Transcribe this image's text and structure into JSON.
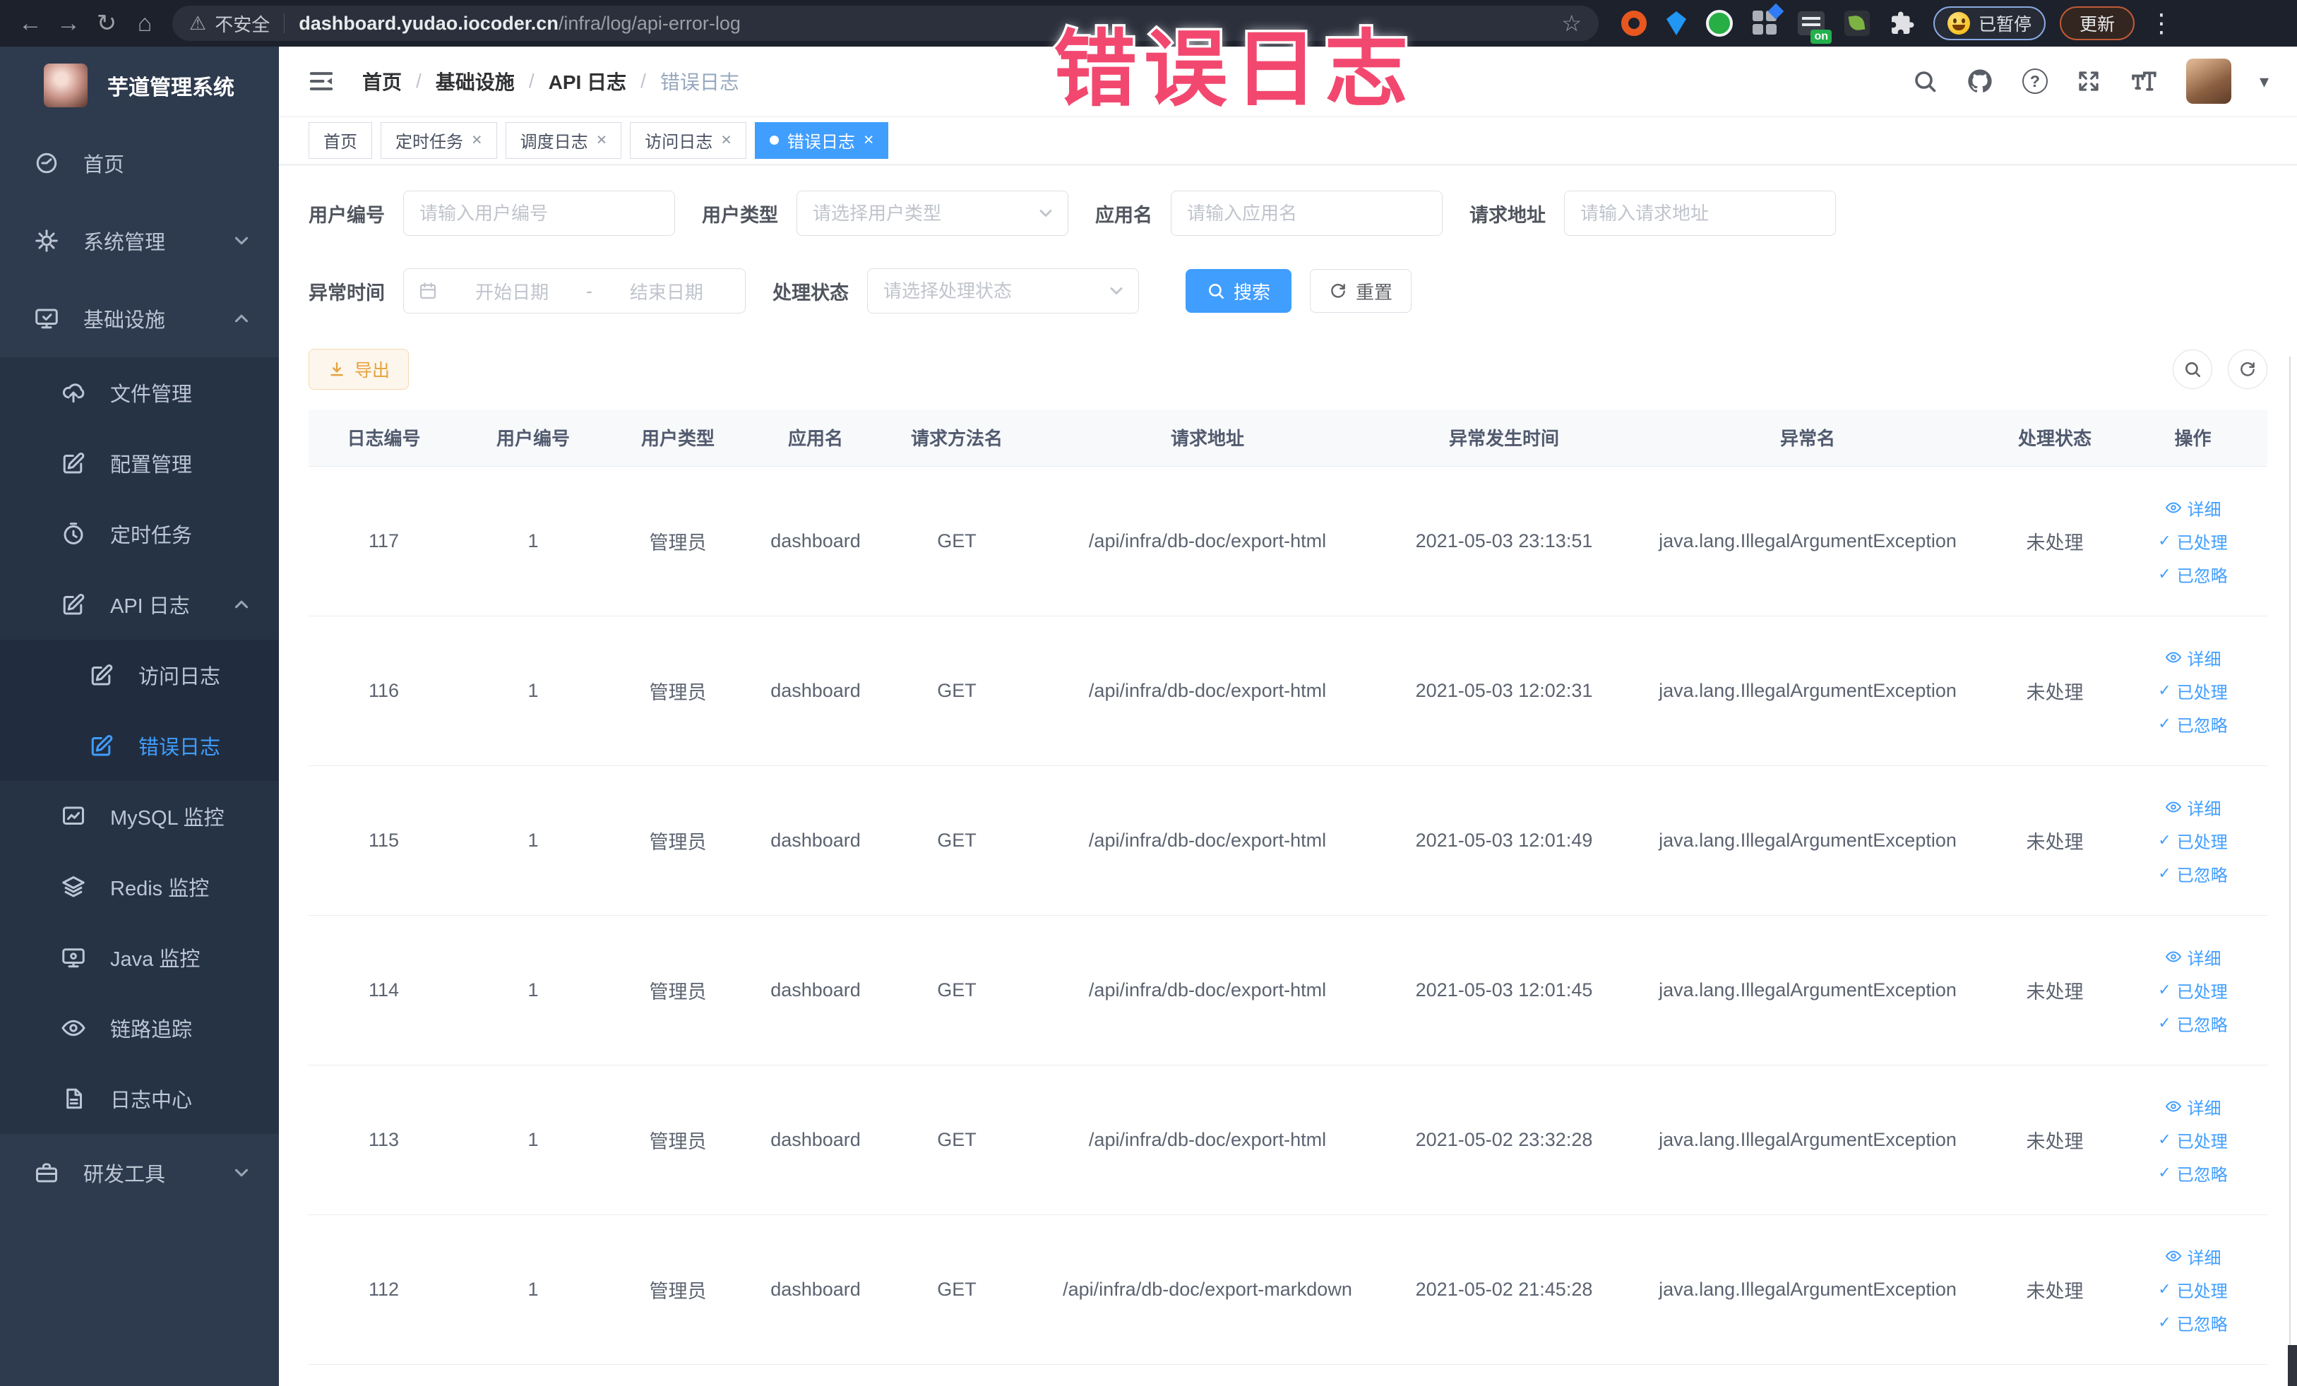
{
  "browser": {
    "security_label": "不安全",
    "url_domain": "dashboard.yudao.iocoder.cn",
    "url_path": "/infra/log/api-error-log",
    "paused_label": "已暂停",
    "update_label": "更新"
  },
  "overlay_title": "错误日志",
  "colors": {
    "accent": "#409eff",
    "sidebar_bg": "#2e3a4e",
    "sidebar_submenu_bg": "#263345",
    "active_link": "#409eff",
    "export_warning": "#e6a23c",
    "overlay_pink": "#f2486f"
  },
  "icons": {
    "back": "←",
    "forward": "→",
    "reload": "↻",
    "home": "⌂",
    "warning": "⚠",
    "star": "☆",
    "dots": "⋮",
    "close": "×",
    "caret_down": "▾",
    "check": "✓",
    "help": "?",
    "on_badge": "on",
    "breadcrumb_separator": "/"
  },
  "sidebar": {
    "logo_title": "芋道管理系统",
    "items": [
      {
        "label": "首页",
        "icon": "dashboard"
      },
      {
        "label": "系统管理",
        "icon": "gear"
      },
      {
        "label": "基础设施",
        "icon": "monitor"
      },
      {
        "label": "文件管理",
        "icon": "cloud-upload"
      },
      {
        "label": "配置管理",
        "icon": "edit"
      },
      {
        "label": "定时任务",
        "icon": "timer"
      },
      {
        "label": "API 日志",
        "icon": "edit"
      },
      {
        "label": "访问日志",
        "icon": "edit"
      },
      {
        "label": "错误日志",
        "icon": "edit"
      },
      {
        "label": "MySQL 监控",
        "icon": "chart"
      },
      {
        "label": "Redis 监控",
        "icon": "layers"
      },
      {
        "label": "Java 监控",
        "icon": "display"
      },
      {
        "label": "链路追踪",
        "icon": "eye"
      },
      {
        "label": "日志中心",
        "icon": "document"
      },
      {
        "label": "研发工具",
        "icon": "briefcase"
      }
    ]
  },
  "breadcrumb": [
    "首页",
    "基础设施",
    "API 日志",
    "错误日志"
  ],
  "tabs": [
    {
      "label": "首页"
    },
    {
      "label": "定时任务"
    },
    {
      "label": "调度日志"
    },
    {
      "label": "访问日志"
    },
    {
      "label": "错误日志"
    }
  ],
  "filters": {
    "user_id_label": "用户编号",
    "user_id_placeholder": "请输入用户编号",
    "user_type_label": "用户类型",
    "user_type_placeholder": "请选择用户类型",
    "app_name_label": "应用名",
    "app_name_placeholder": "请输入应用名",
    "request_url_label": "请求地址",
    "request_url_placeholder": "请输入请求地址",
    "exception_time_label": "异常时间",
    "date_start_placeholder": "开始日期",
    "date_separator": "-",
    "date_end_placeholder": "结束日期",
    "process_status_label": "处理状态",
    "process_status_placeholder": "请选择处理状态",
    "search_label": "搜索",
    "reset_label": "重置"
  },
  "toolbar": {
    "export_label": "导出"
  },
  "table": {
    "columns": [
      "日志编号",
      "用户编号",
      "用户类型",
      "应用名",
      "请求方法名",
      "请求地址",
      "异常发生时间",
      "异常名",
      "处理状态",
      "操作"
    ],
    "ops": {
      "detail": "详细",
      "processed": "已处理",
      "ignored": "已忽略"
    },
    "rows": [
      {
        "log_id": "117",
        "user_id": "1",
        "user_type": "管理员",
        "app_name": "dashboard",
        "method": "GET",
        "url": "/api/infra/db-doc/export-html",
        "time": "2021-05-03 23:13:51",
        "exception": "java.lang.IllegalArgumentException",
        "status": "未处理"
      },
      {
        "log_id": "116",
        "user_id": "1",
        "user_type": "管理员",
        "app_name": "dashboard",
        "method": "GET",
        "url": "/api/infra/db-doc/export-html",
        "time": "2021-05-03 12:02:31",
        "exception": "java.lang.IllegalArgumentException",
        "status": "未处理"
      },
      {
        "log_id": "115",
        "user_id": "1",
        "user_type": "管理员",
        "app_name": "dashboard",
        "method": "GET",
        "url": "/api/infra/db-doc/export-html",
        "time": "2021-05-03 12:01:49",
        "exception": "java.lang.IllegalArgumentException",
        "status": "未处理"
      },
      {
        "log_id": "114",
        "user_id": "1",
        "user_type": "管理员",
        "app_name": "dashboard",
        "method": "GET",
        "url": "/api/infra/db-doc/export-html",
        "time": "2021-05-03 12:01:45",
        "exception": "java.lang.IllegalArgumentException",
        "status": "未处理"
      },
      {
        "log_id": "113",
        "user_id": "1",
        "user_type": "管理员",
        "app_name": "dashboard",
        "method": "GET",
        "url": "/api/infra/db-doc/export-html",
        "time": "2021-05-02 23:32:28",
        "exception": "java.lang.IllegalArgumentException",
        "status": "未处理"
      },
      {
        "log_id": "112",
        "user_id": "1",
        "user_type": "管理员",
        "app_name": "dashboard",
        "method": "GET",
        "url": "/api/infra/db-doc/export-markdown",
        "time": "2021-05-02 21:45:28",
        "exception": "java.lang.IllegalArgumentException",
        "status": "未处理"
      }
    ]
  }
}
